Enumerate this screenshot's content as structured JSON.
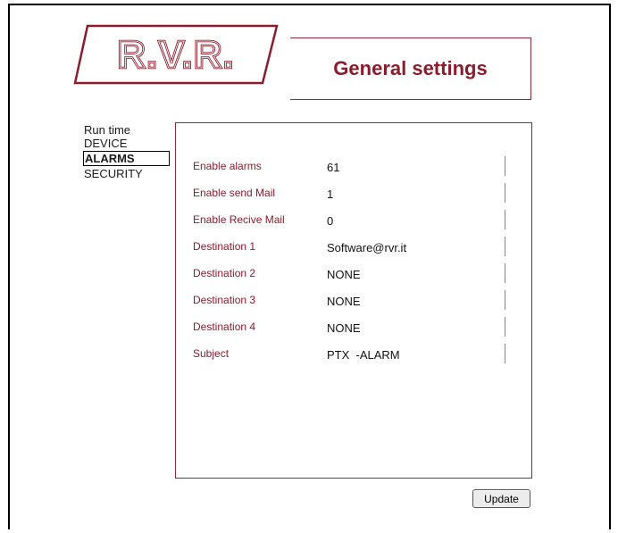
{
  "logo": {
    "text": "R.V.R."
  },
  "header": {
    "title": "General settings"
  },
  "nav": {
    "items": [
      {
        "label": "Run time"
      },
      {
        "label": "DEVICE"
      },
      {
        "label": "ALARMS"
      },
      {
        "label": "SECURITY"
      }
    ]
  },
  "form": {
    "rows": [
      {
        "label": "Enable alarms",
        "value": "61"
      },
      {
        "label": "Enable send Mail",
        "value": "1"
      },
      {
        "label": "Enable Recive Mail",
        "value": "0"
      },
      {
        "label": "Destination 1",
        "value": "Software@rvr.it"
      },
      {
        "label": "Destination 2",
        "value": "NONE"
      },
      {
        "label": "Destination 3",
        "value": "NONE"
      },
      {
        "label": "Destination 4",
        "value": "NONE"
      },
      {
        "label": "Subject",
        "value": "PTX  -ALARM"
      }
    ]
  },
  "actions": {
    "update_label": "Update"
  },
  "colors": {
    "accent": "#8b1c2c",
    "border": "#8b2a34",
    "separator": "#6b8ab0"
  }
}
